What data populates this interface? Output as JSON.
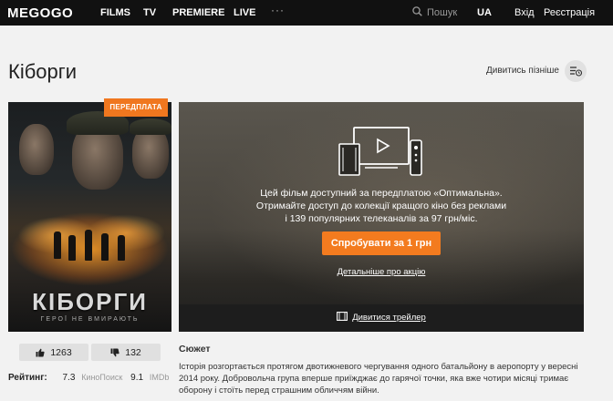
{
  "header": {
    "logo": "MEGOGO",
    "nav": [
      {
        "label": "FILMS"
      },
      {
        "label": "TV"
      },
      {
        "label": "PREMIERE"
      },
      {
        "label": "LIVE"
      }
    ],
    "more": "···",
    "search_placeholder": "Пошук",
    "language": "UA",
    "login": "Вхід",
    "register": "Реєстрація"
  },
  "page": {
    "title": "Кіборги",
    "watch_later": "Дивитись пізніше"
  },
  "poster": {
    "badge": "ПЕРЕДПЛАТА",
    "title": "КІБОРГИ",
    "tagline": "ГЕРОЇ НЕ ВМИРАЮТЬ"
  },
  "panel": {
    "lines": [
      "Цей фільм доступний за передплатою «Оптимальна».",
      "Отримайте доступ до колекції кращого кіно без реклами",
      "і 139 популярних телеканалів за 97 грн/міс."
    ],
    "try_button": "Спробувати за 1 грн",
    "promo_link": "Детальніше про акцію",
    "trailer": "Дивитися трейлер"
  },
  "votes": {
    "likes": "1263",
    "dislikes": "132"
  },
  "ratings": {
    "label": "Рейтинг:",
    "kinopoisk_value": "7.3",
    "kinopoisk_source": "КиноПоиск",
    "imdb_value": "9.1",
    "imdb_source": "IMDb"
  },
  "plot": {
    "heading": "Сюжет",
    "text": "Історія розгортається протягом двотижневого чергування одного батальйону в аеропорту у вересні 2014 року. Добровольча група вперше приїжджає до гарячої точки, яка вже чотири місяці тримає оборону і стоїть перед страшним обличчям війни."
  },
  "colors": {
    "header_bg": "#111111",
    "accent": "#f37b1f",
    "page_bg": "#f2f2f2"
  }
}
